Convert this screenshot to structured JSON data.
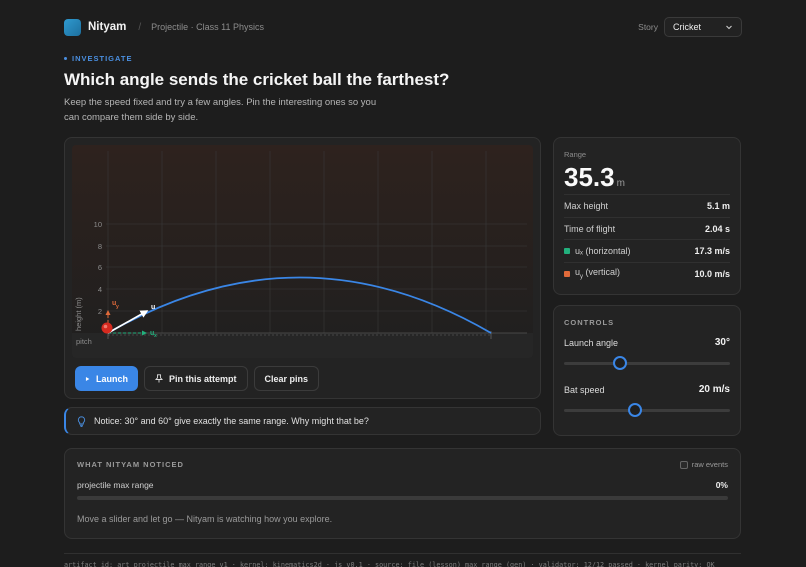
{
  "header": {
    "brand": "Nityam",
    "separator": "/",
    "breadcrumb": "Projectile · Class 11 Physics",
    "story_label": "Story",
    "story_value": "Cricket"
  },
  "intro": {
    "eyebrow": "INVESTIGATE",
    "title": "Which angle sends the cricket ball the farthest?",
    "lede": "Keep the speed fixed and try a few angles. Pin the interesting ones so you can compare them side by side."
  },
  "sim": {
    "y_axis_label": "height (m)",
    "y_ticks": [
      "10",
      "8",
      "6",
      "4",
      "2"
    ],
    "ground_label": "pitch",
    "vector_labels": {
      "u": "u",
      "uy": "u",
      "uy_sub": "y",
      "ux": "u",
      "ux_sub": "x"
    },
    "colors": {
      "trajectory": "#3a86e6",
      "ball": "#d62a1f",
      "ux": "#22b07d",
      "uy": "#e06a3a"
    },
    "trajectory": {
      "range_m": 35.3,
      "max_height_m": 5.1
    }
  },
  "buttons": {
    "launch": "Launch",
    "pin": "Pin this attempt",
    "clear": "Clear pins"
  },
  "notice": {
    "icon": "lightbulb-icon",
    "text": "Notice: 30° and 60° give exactly the same range. Why might that be?"
  },
  "stats": {
    "range_label": "Range",
    "range_value": "35.3",
    "range_unit": "m",
    "rows": [
      {
        "label": "Max height",
        "value": "5.1 m"
      },
      {
        "label": "Time of flight",
        "value": "2.04 s"
      },
      {
        "label": "uₓ (horizontal)",
        "value": "17.3 m/s",
        "color": "#22b07d"
      },
      {
        "label": "u_y (vertical)",
        "value": "10.0 m/s",
        "color": "#e06a3a"
      }
    ],
    "uy_prefix": "u",
    "uy_sub": "y",
    "uy_suffix": " (vertical)"
  },
  "controls": {
    "heading": "CONTROLS",
    "angle_label": "Launch angle",
    "angle_value": "30°",
    "angle_fraction": 0.34,
    "speed_label": "Bat speed",
    "speed_value": "20 m/s",
    "speed_fraction": 0.43
  },
  "noticed": {
    "heading": "WHAT NITYAM NOTICED",
    "raw_label": "raw events",
    "metric_label": "projectile max range",
    "metric_value": "0%",
    "metric_fraction": 0,
    "hint": "Move a slider and let go — Nityam is watching how you explore."
  },
  "footer": {
    "text": "artifact_id: art_projectile_max_range_v1 · kernel: kinematics2d · js v0.1 · source: file (lesson) max_range (gen) · validator: 12/12 passed · kernel parity: OK"
  }
}
